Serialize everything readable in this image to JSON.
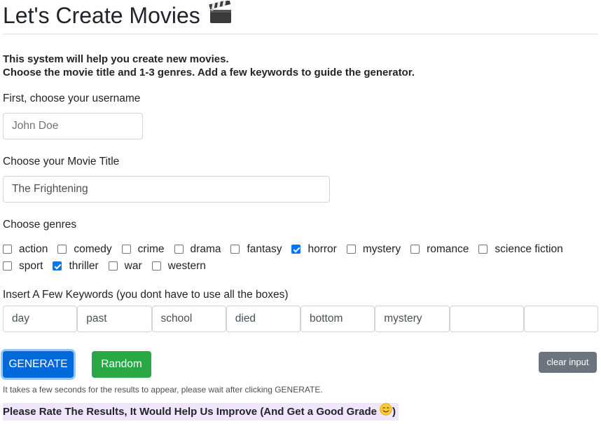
{
  "page": {
    "title": "Let's Create Movies",
    "title_icon": "clapperboard-icon",
    "intro_line1": "This system will help you create new movies.",
    "intro_line2": "Choose the movie title and 1-3 genres. Add a few keywords to guide the generator."
  },
  "username": {
    "label": "First, choose your username",
    "placeholder": "John Doe",
    "value": ""
  },
  "movie_title": {
    "label": "Choose your Movie Title",
    "value": "The Frightening"
  },
  "genres": {
    "label": "Choose genres",
    "items": [
      {
        "label": "action",
        "checked": false
      },
      {
        "label": "comedy",
        "checked": false
      },
      {
        "label": "crime",
        "checked": false
      },
      {
        "label": "drama",
        "checked": false
      },
      {
        "label": "fantasy",
        "checked": false
      },
      {
        "label": "horror",
        "checked": true
      },
      {
        "label": "mystery",
        "checked": false
      },
      {
        "label": "romance",
        "checked": false
      },
      {
        "label": "science fiction",
        "checked": false
      },
      {
        "label": "sport",
        "checked": false
      },
      {
        "label": "thriller",
        "checked": true
      },
      {
        "label": "war",
        "checked": false
      },
      {
        "label": "western",
        "checked": false
      }
    ]
  },
  "keywords": {
    "label": "Insert A Few Keywords (you dont have to use all the boxes)",
    "values": [
      "day",
      "past",
      "school",
      "died",
      "bottom",
      "mystery",
      "",
      ""
    ]
  },
  "buttons": {
    "generate": "GENERATE",
    "random": "Random",
    "clear": "clear input"
  },
  "note": "It takes a few seconds for the results to appear, please wait after clicking GENERATE.",
  "rate": {
    "text": "Please Rate The Results, It Would Help Us Improve (And Get a Good Grade",
    "icon": "smiling-face-icon",
    "suffix": ")"
  },
  "colors": {
    "generate_bg": "#0069d9",
    "random_bg": "#28a745",
    "clear_bg": "#6c757d",
    "checkbox_checked": "#0075ff",
    "rate_highlight": "#f0e6fb"
  }
}
